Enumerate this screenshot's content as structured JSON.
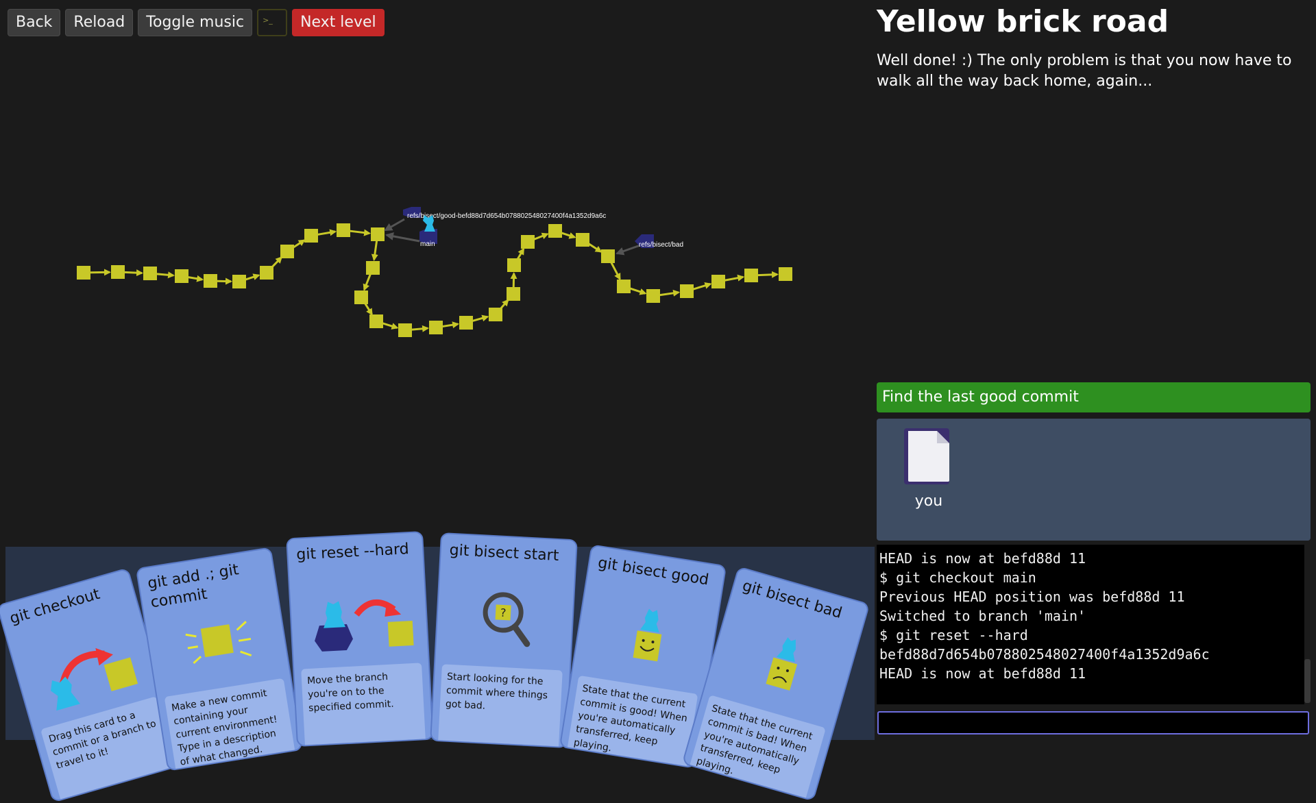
{
  "toolbar": {
    "back": "Back",
    "reload": "Reload",
    "toggle_music": "Toggle music",
    "terminal_glyph": ">_",
    "next_level": "Next level"
  },
  "graph": {
    "head_ref": "refs/bisect/good-befd88d7d654b078802548027400f4a1352d9a6c",
    "branch": "main",
    "bad_ref": "refs/bisect/bad",
    "commit_color": "#c8c828",
    "ref_color": "#2a2a7a",
    "head_color": "#2bbbe8"
  },
  "level": {
    "title": "Yellow brick road",
    "description": "Well done! :) The only problem is that you now have to walk all the way back home, again..."
  },
  "goal": {
    "text": "Find the last good commit",
    "color": "#2e9020"
  },
  "files": [
    {
      "name": "you",
      "icon": "document-icon"
    }
  ],
  "terminal": {
    "lines": [
      "HEAD is now at befd88d 11",
      "$ git checkout main",
      "Previous HEAD position was befd88d 11",
      "Switched to branch 'main'",
      "$ git reset --hard",
      "befd88d7d654b078802548027400f4a1352d9a6c",
      "HEAD is now at befd88d 11"
    ],
    "input_value": ""
  },
  "cards": [
    {
      "title": "git checkout",
      "desc": "Drag this card to a commit or a branch to travel to it!"
    },
    {
      "title": "git add .; git commit",
      "desc": "Make a new commit containing your current environment! Type in a description of what changed."
    },
    {
      "title": "git reset --hard",
      "desc": "Move the branch you're on to the specified commit."
    },
    {
      "title": "git bisect start",
      "desc": "Start looking for the commit where things got bad."
    },
    {
      "title": "git bisect good",
      "desc": "State that the current commit is good! When you're automatically transferred, keep playing."
    },
    {
      "title": "git bisect bad",
      "desc": "State that the current commit is bad! When you're automatically transferred, keep playing."
    }
  ]
}
